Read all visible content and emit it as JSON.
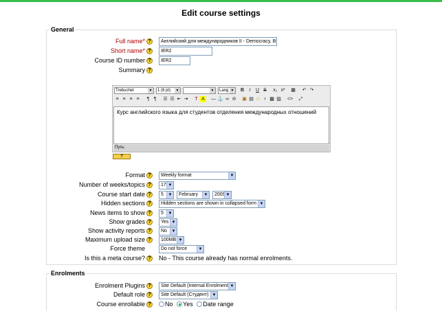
{
  "page": {
    "title": "Edit course settings"
  },
  "general": {
    "legend": "General",
    "full_name": {
      "label": "Full name*",
      "value": "Английский для международников II - Democracy, Business."
    },
    "short_name": {
      "label": "Short name*",
      "value": "IER2"
    },
    "course_id": {
      "label": "Course ID number",
      "value": "IER2"
    },
    "summary": {
      "label": "Summary",
      "toolbar": {
        "font": "Trebuchet",
        "size": "1 (8 pt)",
        "style": "",
        "lang": "Lang",
        "buttons_row1": [
          "B",
          "I",
          "U",
          "S",
          "x₂",
          "x²",
          "▦",
          "↶",
          "↷"
        ],
        "buttons_row2": [
          "≡",
          "≡",
          "≡",
          "≡",
          "¶",
          "¶",
          "☰",
          "☰",
          "⇤",
          "⇥",
          "T",
          "A",
          "—",
          "⚓",
          "∞",
          "⊘",
          "▣",
          "▤",
          "☺",
          "♀",
          "▩",
          "▨",
          "<>",
          "⤢"
        ]
      },
      "text": "Курс английского языка для студентов отделения международных отношений",
      "path_label": "Путь:",
      "help_label": "?"
    },
    "format": {
      "label": "Format",
      "value": "Weekly format"
    },
    "num_sections": {
      "label": "Number of weeks/topics",
      "value": "17"
    },
    "start_date": {
      "label": "Course start date",
      "day": "5",
      "month": "February",
      "year": "2009"
    },
    "hidden_sections": {
      "label": "Hidden sections",
      "value": "Hidden sections are shown in collapsed form"
    },
    "news_items": {
      "label": "News items to show",
      "value": "5"
    },
    "show_grades": {
      "label": "Show grades",
      "value": "Yes"
    },
    "show_reports": {
      "label": "Show activity reports",
      "value": "No"
    },
    "max_upload": {
      "label": "Maximum upload size",
      "value": "100MB"
    },
    "force_theme": {
      "label": "Force theme",
      "value": "Do not force"
    },
    "meta_course": {
      "label": "Is this a meta course?",
      "value": "No - This course already has normal enrolments."
    }
  },
  "enrolments": {
    "legend": "Enrolments",
    "plugins": {
      "label": "Enrolment Plugins",
      "value": "Site Default (Internal Enrolment)"
    },
    "default_role": {
      "label": "Default role",
      "value": "Site Default (Студент)"
    },
    "enrollable": {
      "label": "Course enrollable",
      "options": [
        "No",
        "Yes",
        "Date range"
      ],
      "selected": "Yes"
    }
  },
  "colors": {
    "accent": "#3cbd4a",
    "required": "#aa0000",
    "help": "#f6d635"
  }
}
